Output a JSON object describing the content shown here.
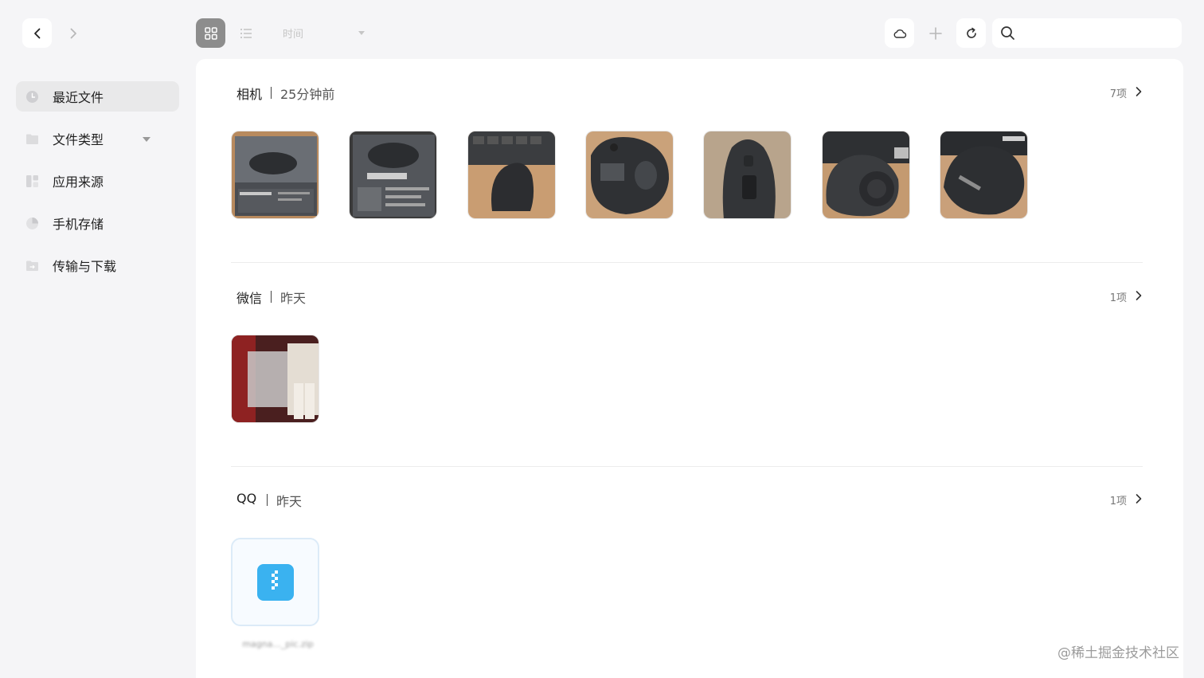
{
  "toolbar": {
    "back_icon": "chevron-left-icon",
    "forward_icon": "chevron-right-icon",
    "grid_view_icon": "grid-icon",
    "list_view_icon": "list-icon",
    "sort_value": "时间",
    "cloud_icon": "cloud-icon",
    "add_icon": "plus-icon",
    "refresh_icon": "refresh-icon",
    "search_icon": "search-icon",
    "search_value": ""
  },
  "sidebar": {
    "items": [
      {
        "label": "最近文件",
        "icon": "clock-icon",
        "selected": true
      },
      {
        "label": "文件类型",
        "icon": "folder-icon",
        "selected": false
      },
      {
        "label": "应用来源",
        "icon": "apps-icon",
        "selected": false
      },
      {
        "label": "手机存储",
        "icon": "pie-chart-icon",
        "selected": false
      },
      {
        "label": "传输与下载",
        "icon": "transfer-folder-icon",
        "selected": false
      }
    ]
  },
  "sections": [
    {
      "source": "相机",
      "time": "25分钟前",
      "count": "7项"
    },
    {
      "source": "微信",
      "time": "昨天",
      "count": "1项"
    },
    {
      "source": "QQ",
      "time": "昨天",
      "count": "1项",
      "file_name": "magna..._pic.zip"
    }
  ],
  "watermark": "@稀土掘金技术社区",
  "colors": {
    "accent": "#3ab2f0",
    "selected_bg": "#e9e9ea",
    "active_toggle": "#8d8d8d"
  }
}
